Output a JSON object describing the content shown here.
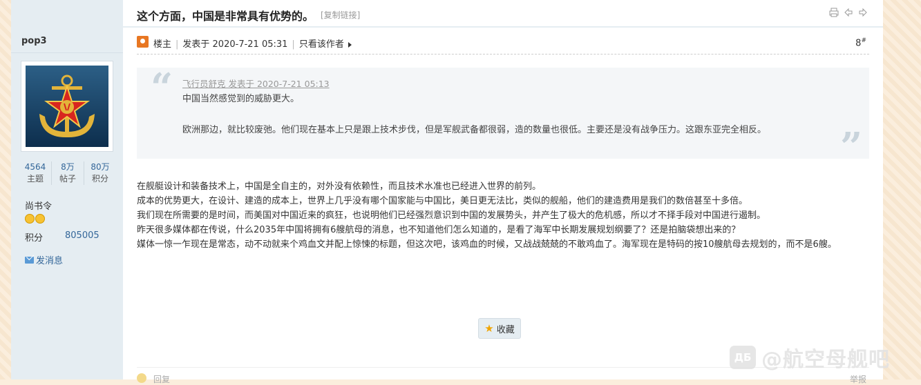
{
  "thread": {
    "title": "这个方面，中国是非常具有优势的。",
    "copy_link": "[复制链接]"
  },
  "user": {
    "name": "pop3",
    "stats": [
      {
        "num": "4564",
        "label": "主题"
      },
      {
        "num": "8万",
        "label": "帖子"
      },
      {
        "num": "80万",
        "label": "积分"
      }
    ],
    "rank": "尚书令",
    "points_label": "积分",
    "points_value": "805005",
    "pm_label": "发消息"
  },
  "post": {
    "op_label": "楼主",
    "posted_at": "发表于 2020-7-21 05:31",
    "only_author": "只看该作者",
    "floor": "8",
    "floor_sup": "#",
    "quote": {
      "header": "飞行员舒克 发表于 2020-7-21 05:13",
      "line1": "中国当然感觉到的威胁更大。",
      "line2": "欧洲那边，就比较废弛。他们现在基本上只是跟上技术步伐，但是军舰武备都很弱，造的数量也很低。主要还是没有战争压力。这跟东亚完全相反。"
    },
    "body": [
      "在舰艇设计和装备技术上，中国是全自主的，对外没有依赖性，而且技术水准也已经进入世界的前列。",
      "成本的优势更大，在设计、建造的成本上，世界上几乎没有哪个国家能与中国比，美日更无法比，类似的舰船，他们的建造费用是我们的数倍甚至十多倍。",
      "我们现在所需要的是时间，而美国对中国近来的疯狂，也说明他们已经强烈意识到中国的发展势头，并产生了极大的危机感，所以才不择手段对中国进行遏制。",
      "昨天很多媒体都在传说，什么2035年中国将拥有6艘航母的消息，也不知道他们怎么知道的，是看了海军中长期发展规划纲要了？还是拍脑袋想出来的？",
      "媒体一惊一乍现在是常态，动不动就来个鸡血文并配上惊悚的标题，但这次吧，该鸡血的时候，又战战兢兢的不敢鸡血了。海军现在是特码的按10艘航母去规划的，而不是6艘。"
    ],
    "favorite_label": "收藏"
  },
  "footer": {
    "reply_label": "回复",
    "report_label": "举报"
  },
  "watermark": {
    "logo_text": "ДБ",
    "text": "@航空母舰吧"
  }
}
